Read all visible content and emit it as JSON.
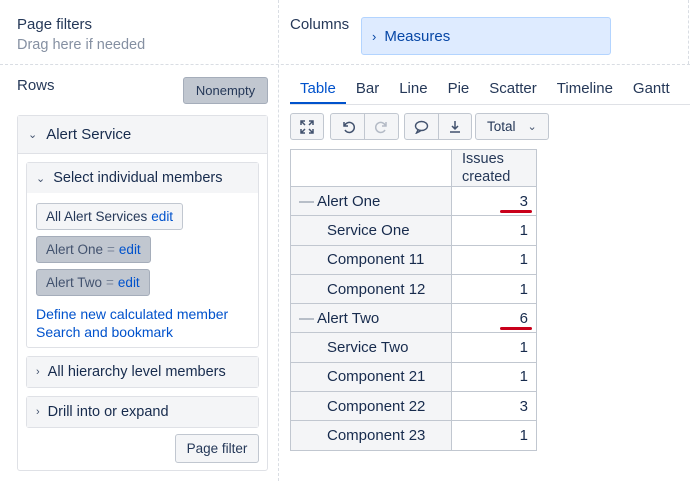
{
  "page_filters": {
    "title": "Page filters",
    "hint": "Drag here if needed"
  },
  "columns": {
    "title": "Columns",
    "chip_label": "Measures"
  },
  "rows": {
    "title": "Rows",
    "nonempty_label": "Nonempty",
    "dimension": {
      "name": "Alert Service",
      "select_members": {
        "label": "Select individual members",
        "members": [
          {
            "label": "All Alert Services",
            "link": "edit",
            "eq": ""
          },
          {
            "label": "Alert One",
            "eq": "=",
            "link": "edit"
          },
          {
            "label": "Alert Two",
            "eq": "=",
            "link": "edit"
          }
        ],
        "define_link": "Define new calculated member",
        "search_link": "Search and bookmark"
      },
      "hierarchy_label": "All hierarchy level members",
      "drill_label": "Drill into or expand"
    },
    "page_filter_label": "Page filter"
  },
  "view_tabs": [
    "Table",
    "Bar",
    "Line",
    "Pie",
    "Scatter",
    "Timeline",
    "Gantt"
  ],
  "active_tab": "Table",
  "toolbar": {
    "icons": [
      "fullscreen-icon",
      "undo-icon",
      "redo-icon",
      "comment-icon",
      "export-icon"
    ],
    "total_label": "Total"
  },
  "table": {
    "column_header_line1": "Issues",
    "column_header_line2": "created",
    "rows": [
      {
        "label": "Alert One",
        "value": "3",
        "level": 1,
        "expanded_marker": "—",
        "highlighted": true
      },
      {
        "label": "Service One",
        "value": "1",
        "level": 2
      },
      {
        "label": "Component 11",
        "value": "1",
        "level": 2
      },
      {
        "label": "Component 12",
        "value": "1",
        "level": 2
      },
      {
        "label": "Alert Two",
        "value": "6",
        "level": 1,
        "expanded_marker": "—",
        "highlighted": true
      },
      {
        "label": "Service Two",
        "value": "1",
        "level": 2
      },
      {
        "label": "Component 21",
        "value": "1",
        "level": 2
      },
      {
        "label": "Component 22",
        "value": "3",
        "level": 2
      },
      {
        "label": "Component 23",
        "value": "1",
        "level": 2
      }
    ]
  },
  "colors": {
    "accent": "#0052cc",
    "highlight_underline": "#c9001b",
    "chip_bg": "#deebff"
  }
}
